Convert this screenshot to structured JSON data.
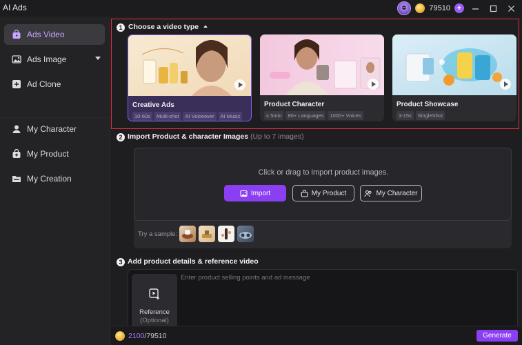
{
  "app": {
    "title": "AI Ads"
  },
  "titlebar": {
    "credits": "79510"
  },
  "sidebar": {
    "items": [
      {
        "label": "Ads Video",
        "icon": "video-bag-icon"
      },
      {
        "label": "Ads Image",
        "icon": "image-icon"
      },
      {
        "label": "Ad Clone",
        "icon": "add-clone-icon"
      },
      {
        "label": "My Character",
        "icon": "user-icon"
      },
      {
        "label": "My Product",
        "icon": "product-bag-icon"
      },
      {
        "label": "My Creation",
        "icon": "folder-icon"
      }
    ]
  },
  "section1": {
    "num": "1",
    "title": "Choose a video type",
    "cards": [
      {
        "title": "Creative Ads",
        "tags": [
          "10-60s",
          "Multi-shot",
          "AI Voiceover",
          "AI Music"
        ]
      },
      {
        "title": "Product Character",
        "tags": [
          "≤ 5min",
          "80+ Languages",
          "1000+ Voices"
        ]
      },
      {
        "title": "Product Showcase",
        "tags": [
          "3-15s",
          "SingleShot"
        ]
      }
    ]
  },
  "section2": {
    "num": "2",
    "title": "Import Product & character Images",
    "subtitle": "(Up to 7 images)",
    "drop_text": "Click or drag to import product images.",
    "import_label": "Import",
    "my_product_label": "My Product",
    "my_character_label": "My Character",
    "sample_label": "Try a sample:"
  },
  "section3": {
    "num": "3",
    "title": "Add product details & reference video",
    "placeholder": "Enter product selling points and ad message",
    "reference_label": "Reference",
    "reference_sub": "(Optional)"
  },
  "bottom": {
    "used": "2100",
    "total": "/79510",
    "generate_label": "Generate"
  },
  "colors": {
    "accent": "#8b3ff2",
    "highlight_border": "#e0313b",
    "active_nav_text": "#c7a6ff"
  }
}
